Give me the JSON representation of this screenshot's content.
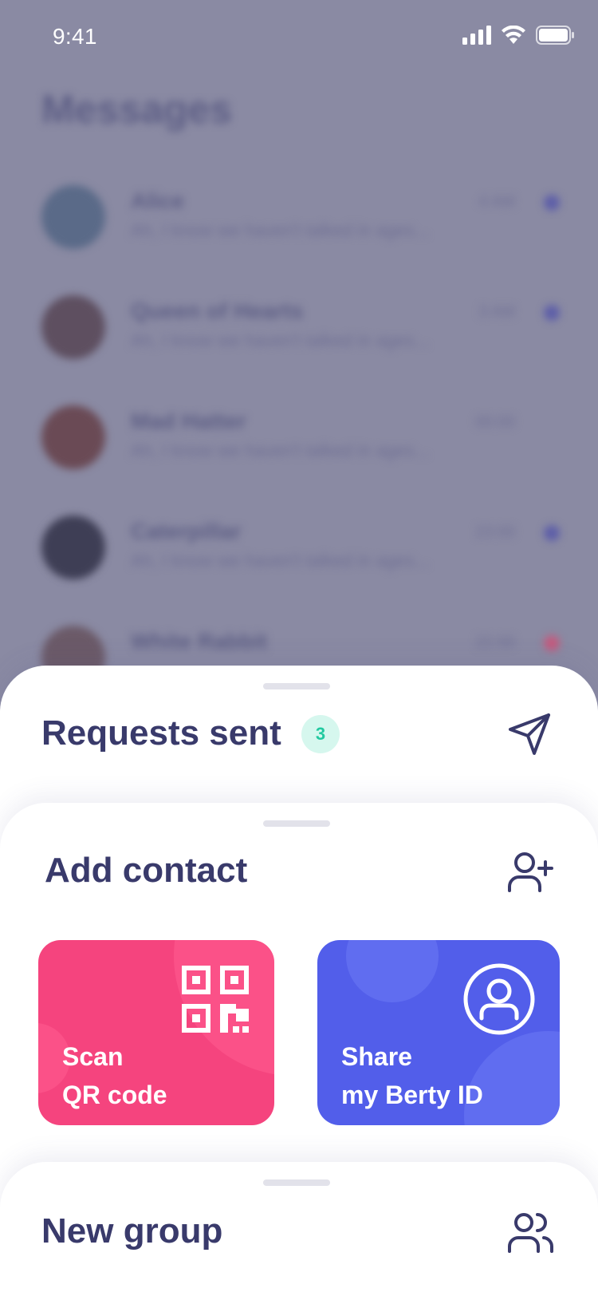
{
  "status_bar": {
    "time": "9:41"
  },
  "background": {
    "title": "Messages",
    "conversations": [
      {
        "name": "Alice",
        "preview": "Ah, I know we haven't talked in ages...",
        "time": "4 AM"
      },
      {
        "name": "Queen of Hearts",
        "preview": "Ah, I know we haven't talked in ages...",
        "time": "3 AM"
      },
      {
        "name": "Mad Hatter",
        "preview": "Ah, I know we haven't talked in ages...",
        "time": "00:00"
      },
      {
        "name": "Caterpillar",
        "preview": "Ah, I know we haven't talked in ages...",
        "time": "23:00"
      },
      {
        "name": "White Rabbit",
        "preview": "",
        "time": "22:00"
      }
    ]
  },
  "requests_sent": {
    "title": "Requests sent",
    "count": "3"
  },
  "add_contact": {
    "title": "Add contact",
    "scan_card": {
      "line1": "Scan",
      "line2": "QR code"
    },
    "share_card": {
      "line1": "Share",
      "line2": "my Berty ID"
    }
  },
  "new_group": {
    "title": "New group"
  },
  "colors": {
    "title": "#393a6b",
    "scan_card": "#f5447e",
    "share_card": "#525eea",
    "badge_bg": "#d6f7ee",
    "badge_fg": "#22c9a0"
  }
}
